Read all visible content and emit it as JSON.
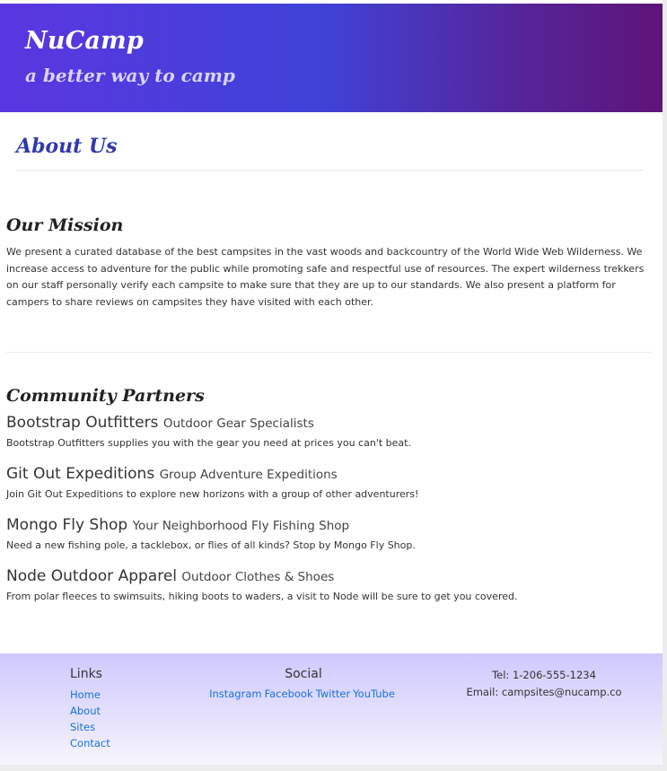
{
  "header": {
    "brand": "NuCamp",
    "tagline": "a better way to camp"
  },
  "about": {
    "title": "About Us"
  },
  "mission": {
    "title": "Our Mission",
    "text": "We present a curated database of the best campsites in the vast woods and backcountry of the World Wide Web Wilderness. We increase access to adventure for the public while promoting safe and respectful use of resources. The expert wilderness trekkers on our staff personally verify each campsite to make sure that they are up to our standards. We also present a platform for campers to share reviews on campsites they have visited with each other."
  },
  "partners": {
    "title": "Community Partners",
    "items": [
      {
        "name": "Bootstrap Outfitters",
        "subtitle": "Outdoor Gear Specialists",
        "description": "Bootstrap Outfitters supplies you with the gear you need at prices you can't beat."
      },
      {
        "name": "Git Out Expeditions",
        "subtitle": "Group Adventure Expeditions",
        "description": "Join Git Out Expeditions to explore new horizons with a group of other adventurers!"
      },
      {
        "name": "Mongo Fly Shop",
        "subtitle": "Your Neighborhood Fly Fishing Shop",
        "description": "Need a new fishing pole, a tacklebox, or flies of all kinds? Stop by Mongo Fly Shop."
      },
      {
        "name": "Node Outdoor Apparel",
        "subtitle": "Outdoor Clothes & Shoes",
        "description": "From polar fleeces to swimsuits, hiking boots to waders, a visit to Node will be sure to get you covered."
      }
    ]
  },
  "footer": {
    "links": {
      "title": "Links",
      "items": [
        "Home",
        "About",
        "Sites",
        "Contact"
      ]
    },
    "social": {
      "title": "Social",
      "items": [
        "Instagram",
        "Facebook",
        "Twitter",
        "YouTube"
      ]
    },
    "contact": {
      "tel": "Tel: 1-206-555-1234",
      "email": "Email: campsites@nucamp.co"
    }
  },
  "colors": {
    "link": "#1a73d9",
    "heading_accent": "#2f3aa8",
    "header_gradient_start": "#5a36e0",
    "header_gradient_end": "#5e1479"
  }
}
